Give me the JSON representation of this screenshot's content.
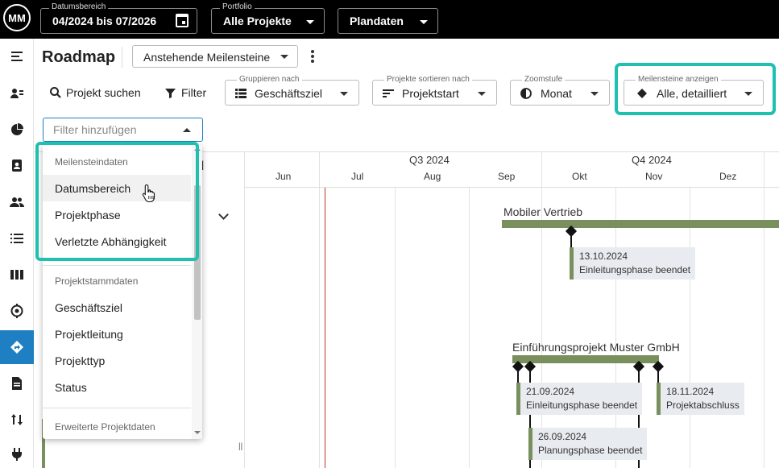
{
  "logo": {
    "text": "MM"
  },
  "top_bar": {
    "date_range": {
      "label": "Datumsbereich",
      "value": "04/2024 bis 07/2026"
    },
    "portfolio": {
      "label": "Portfolio",
      "value": "Alle Projekte"
    },
    "data_type": {
      "value": "Plandaten"
    }
  },
  "left_nav": {
    "items": [
      {
        "icon": "menu-icon"
      },
      {
        "icon": "person-list-icon"
      },
      {
        "icon": "dashboard-icon"
      },
      {
        "icon": "clipboard-person-icon"
      },
      {
        "icon": "people-icon"
      },
      {
        "icon": "list-icon"
      },
      {
        "icon": "columns-icon"
      },
      {
        "icon": "target-icon"
      },
      {
        "icon": "roadmap-icon",
        "active": true
      },
      {
        "icon": "document-icon"
      },
      {
        "icon": "swap-icon"
      },
      {
        "icon": "plug-icon"
      }
    ],
    "active_color": "#1e7fc2"
  },
  "header": {
    "title": "Roadmap",
    "view_select": {
      "value": "Anstehende Meilensteine"
    }
  },
  "toolbar": {
    "search_label": "Projekt suchen",
    "filter_label": "Filter",
    "group_by": {
      "label": "Gruppieren nach",
      "value": "Geschäftsziel"
    },
    "sort_by": {
      "label": "Projekte sortieren nach",
      "value": "Projektstart"
    },
    "zoom": {
      "label": "Zoomstufe",
      "value": "Monat"
    },
    "milestones": {
      "label": "Meilensteine anzeigen",
      "value": "Alle, detailliert"
    }
  },
  "filter_input": {
    "placeholder": "Filter hinzufügen"
  },
  "dropdown": {
    "groups": [
      {
        "title": "Meilensteindaten",
        "items": [
          "Datumsbereich",
          "Projektphase",
          "Verletzte Abhängigkeit"
        ]
      },
      {
        "title": "Projektstammdaten",
        "items": [
          "Geschäftsziel",
          "Projektleitung",
          "Projekttyp",
          "Status"
        ]
      },
      {
        "title": "Erweiterte Projektdaten",
        "items": []
      }
    ],
    "hovered_item": "Datumsbereich"
  },
  "highlight_color": "#1fc0b0",
  "timeline": {
    "column_header": "el",
    "quarters": [
      "Q3 2024",
      "Q4 2024"
    ],
    "months": [
      "Jun",
      "Jul",
      "Aug",
      "Sep",
      "Okt",
      "Nov",
      "Dez"
    ],
    "bar_color": "#7a8f5e",
    "projects": [
      {
        "name": "Mobiler Vertrieb",
        "milestones": [
          {
            "date": "13.10.2024",
            "label": "Einleitungsphase beendet"
          }
        ]
      },
      {
        "name": "Einführungsprojekt Muster GmbH",
        "milestones": [
          {
            "date": "21.09.2024",
            "label": "Einleitungsphase beendet"
          },
          {
            "date": "26.09.2024",
            "label": "Planungsphase beendet"
          },
          {
            "date": "18.11.2024",
            "label": "Projektabschluss"
          }
        ]
      }
    ]
  }
}
